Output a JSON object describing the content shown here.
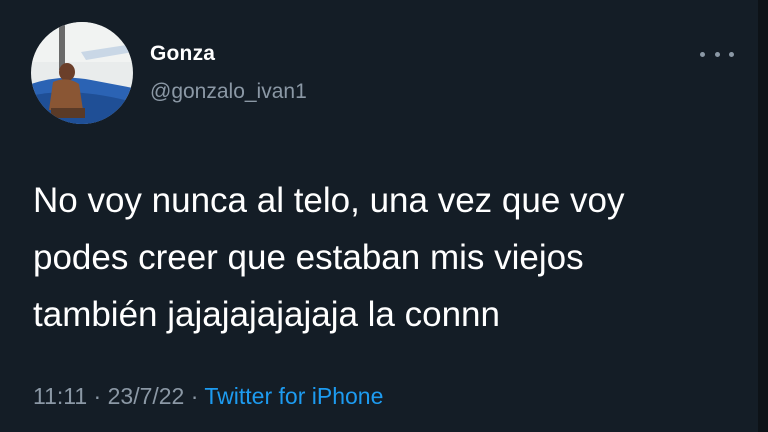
{
  "user": {
    "display_name": "Gonza",
    "handle": "@gonzalo_ivan1"
  },
  "tweet": {
    "text_lines": [
      "No voy nunca al telo, una vez que voy",
      "podes creer que estaban mis viejos",
      "también jajajajajajaja la connn"
    ],
    "time": "11:11",
    "date": "23/7/22",
    "separator": "·",
    "source": "Twitter for iPhone"
  },
  "icons": {
    "more": "more-options-icon",
    "avatar": "profile-photo"
  },
  "colors": {
    "background": "#141d26",
    "text": "#ffffff",
    "secondary": "#8b98a5",
    "link": "#1d9bf0"
  }
}
